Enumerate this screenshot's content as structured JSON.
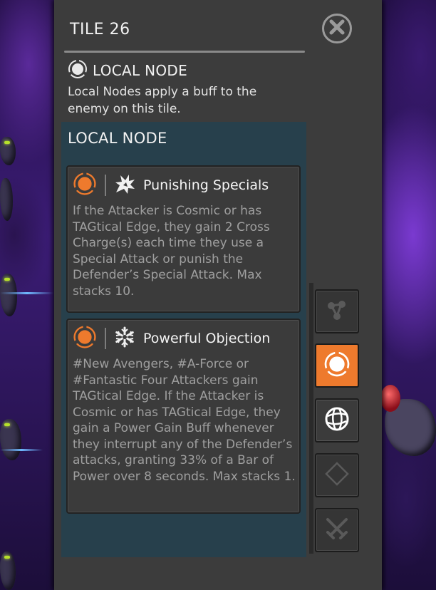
{
  "panel": {
    "title": "TILE 26",
    "node_type_label": "LOCAL NODE",
    "node_description": "Local Nodes apply a buff to the enemy on this tile.",
    "section_title": "LOCAL NODE"
  },
  "nodes": [
    {
      "name": "Punishing Specials",
      "description": "If the Attacker is Cosmic or has TAGtical Edge, they gain 2 Cross Charge(s) each time they use a Special Attack or punish the Defender’s Special Attack. Max stacks 10.",
      "icon": "burst-icon"
    },
    {
      "name": "Powerful Objection",
      "description": "#New Avengers, #A-Force or #Fantastic Four Attackers gain TAGtical Edge. If the Attacker is Cosmic or has TAGtical Edge, they gain a Power Gain Buff whenever they interrupt any of the Defender’s attacks, granting 33% of a Bar of Power over 8 seconds. Max stacks 1.",
      "icon": "snowflake-icon"
    }
  ],
  "sidebar_buttons": [
    {
      "icon": "network-nodes-icon",
      "state": "inactive"
    },
    {
      "icon": "local-node-icon",
      "state": "selected"
    },
    {
      "icon": "globe-icon",
      "state": "active"
    },
    {
      "icon": "diamond-icon",
      "state": "inactive"
    },
    {
      "icon": "crossed-swords-icon",
      "state": "inactive"
    }
  ],
  "colors": {
    "accent_orange": "#ee7a2d",
    "panel": "#3c3c3c",
    "section": "#27404c",
    "card": "#3b3b3b"
  }
}
